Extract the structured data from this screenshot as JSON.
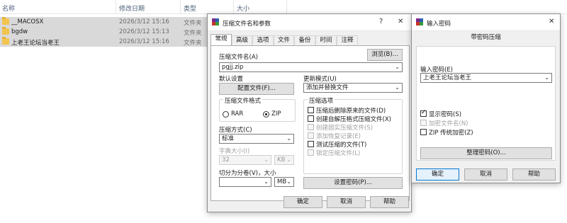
{
  "explorer": {
    "columns": [
      "名称",
      "修改日期",
      "类型",
      "大小"
    ],
    "rows": [
      {
        "name": "__MACOSX",
        "date": "2026/3/12 15:16",
        "type": "文件夹"
      },
      {
        "name": "bgdw",
        "date": "2026/3/12 15:13",
        "type": "文件夹"
      },
      {
        "name": "上老王论坛当老王",
        "date": "2026/3/12 15:16",
        "type": "文件夹"
      }
    ]
  },
  "archive_dialog": {
    "title": "压缩文件名和参数",
    "help_glyph": "?",
    "close_glyph": "✕",
    "tabs": [
      "常规",
      "高级",
      "选项",
      "文件",
      "备份",
      "时间",
      "注释"
    ],
    "archive_name_label": "压缩文件名(A)",
    "browse_label": "浏览(B)...",
    "archive_name_value": "pgjj.zip",
    "default_profile_label": "默认设置",
    "profiles_button": "配置文件(F)...",
    "update_mode_label": "更新模式(U)",
    "update_mode_value": "添加并替换文件",
    "format_group_label": "压缩文件格式",
    "format_rar": "RAR",
    "format_zip": "ZIP",
    "options_group_label": "压缩选项",
    "options": [
      {
        "label": "压缩后删除原来的文件(D)",
        "checked": false,
        "enabled": true
      },
      {
        "label": "创建自解压格式压缩文件(X)",
        "checked": false,
        "enabled": true
      },
      {
        "label": "创建固实压缩文件(S)",
        "checked": false,
        "enabled": false
      },
      {
        "label": "添加恢复记录(E)",
        "checked": false,
        "enabled": false
      },
      {
        "label": "测试压缩的文件(T)",
        "checked": false,
        "enabled": true
      },
      {
        "label": "锁定压缩文件(L)",
        "checked": false,
        "enabled": false
      }
    ],
    "method_label": "压缩方式(C)",
    "method_value": "标准",
    "dict_label": "字典大小(I)",
    "dict_value": "32",
    "dict_unit": "KB",
    "split_label": "切分为分卷(V)，大小",
    "split_value": "",
    "split_unit": "MB",
    "set_password_button": "设置密码(P)...",
    "ok": "确定",
    "cancel": "取消",
    "help": "帮助"
  },
  "password_dialog": {
    "title": "输入密码",
    "close_glyph": "✕",
    "header": "带密码压缩",
    "enter_label": "输入密码(E)",
    "password_value": "上老王论坛当老王",
    "show_password": "显示密码(S)",
    "encrypt_names": "加密文件名(N)",
    "zip_legacy": "ZIP 传统加密(Z)",
    "organize_button": "整理密码(O)...",
    "ok": "确定",
    "cancel": "取消",
    "help": "帮助"
  },
  "colors": {
    "folder": "#f3c44e",
    "accent": "#0078d7",
    "selection": "#d9d9d9"
  }
}
